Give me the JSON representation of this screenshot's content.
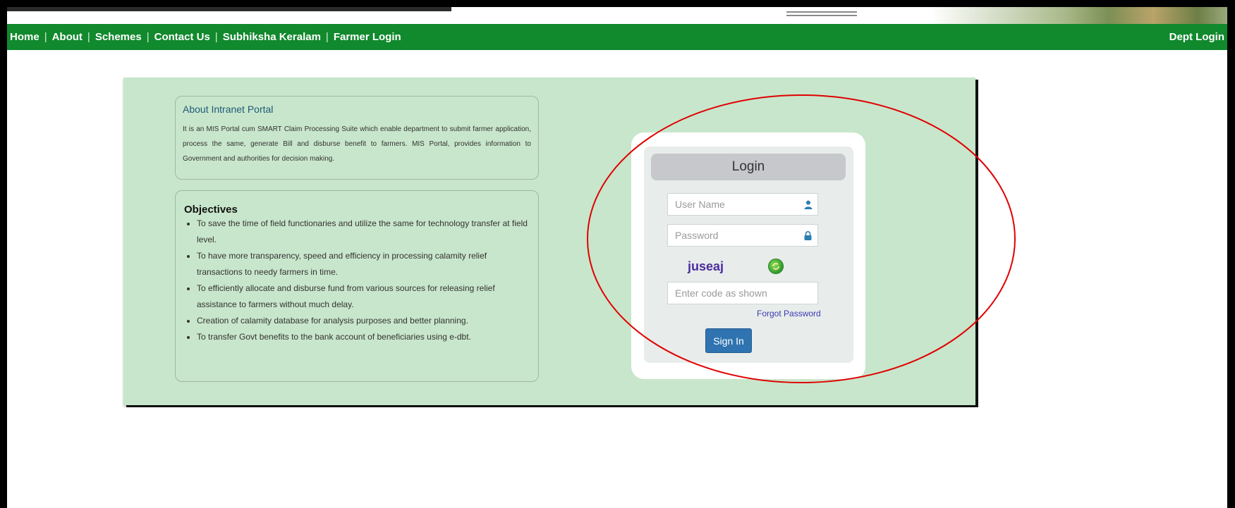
{
  "nav": {
    "items": [
      {
        "label": "Home"
      },
      {
        "label": "About"
      },
      {
        "label": "Schemes"
      },
      {
        "label": "Contact Us"
      },
      {
        "label": "Subhiksha Keralam"
      },
      {
        "label": "Farmer Login"
      }
    ],
    "separator": "|",
    "right_label": "Dept Login",
    "bg_color": "#11892d"
  },
  "about": {
    "title": "About Intranet Portal",
    "text": "It is an MIS Portal cum SMART Claim Processing Suite which enable department to submit farmer application, process the same, generate Bill and disburse benefit to farmers. MIS Portal, provides information to Government and authorities for decision making."
  },
  "objectives": {
    "title": "Objectives",
    "items": [
      "To save the time of field functionaries and utilize the same for technology transfer at field level.",
      "To have more transparency, speed and efficiency in processing calamity relief transactions to needy farmers in time.",
      "To efficiently allocate and disburse fund from various sources for releasing relief assistance to farmers without much delay.",
      "Creation of calamity database for analysis purposes and better planning.",
      "To transfer Govt benefits to the bank account of beneficiaries using e-dbt."
    ]
  },
  "login": {
    "title": "Login",
    "username_placeholder": "User Name",
    "password_placeholder": "Password",
    "captcha_text": "juseaj",
    "code_placeholder": "Enter code as shown",
    "forgot_label": "Forgot Password",
    "signin_label": "Sign In",
    "icons": {
      "user": "user-icon",
      "lock": "lock-icon",
      "refresh": "refresh-icon"
    }
  },
  "colors": {
    "panel_bg": "#c8e6cb",
    "signin_bg": "#2f74b0",
    "annotation": "#e00000"
  }
}
